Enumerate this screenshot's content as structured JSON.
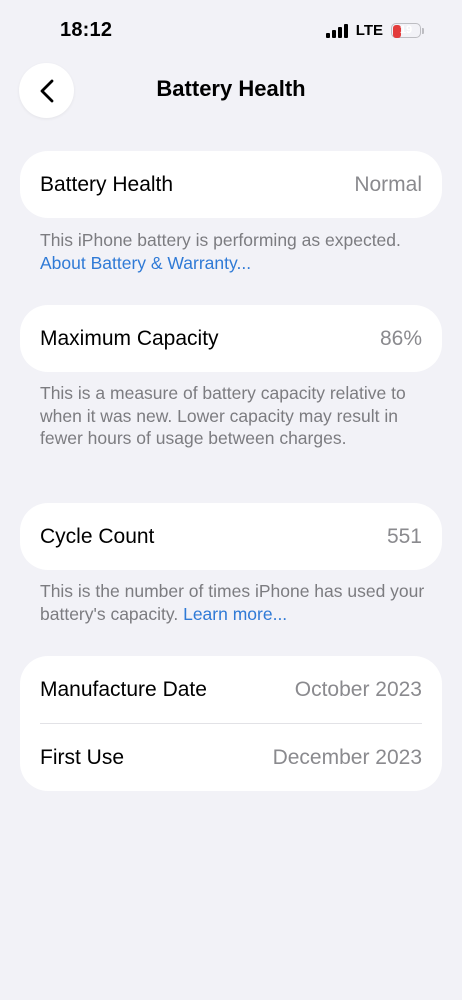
{
  "status_bar": {
    "time": "18:12",
    "network": "LTE",
    "battery_level": "19",
    "battery_fraction": 0.19
  },
  "nav": {
    "back_icon": "chevron-left-icon",
    "title": "Battery Health"
  },
  "battery_health": {
    "label": "Battery Health",
    "value": "Normal",
    "description": "This iPhone battery is performing as expected.",
    "link": "About Battery & Warranty..."
  },
  "maximum_capacity": {
    "label": "Maximum Capacity",
    "value": "86%",
    "description": "This is a measure of battery capacity relative to when it was new. Lower capacity may result in fewer hours of usage between charges."
  },
  "cycle_count": {
    "label": "Cycle Count",
    "value": "551",
    "description": "This is the number of times iPhone has used your battery's capacity.",
    "link": "Learn more..."
  },
  "dates": {
    "manufacture_label": "Manufacture Date",
    "manufacture_value": "October 2023",
    "first_use_label": "First Use",
    "first_use_value": "December 2023"
  },
  "colors": {
    "background": "#f2f2f7",
    "card": "#ffffff",
    "link": "#2f7ad6",
    "secondary_text": "#8a8a8e",
    "battery_low": "#e33b3b"
  }
}
